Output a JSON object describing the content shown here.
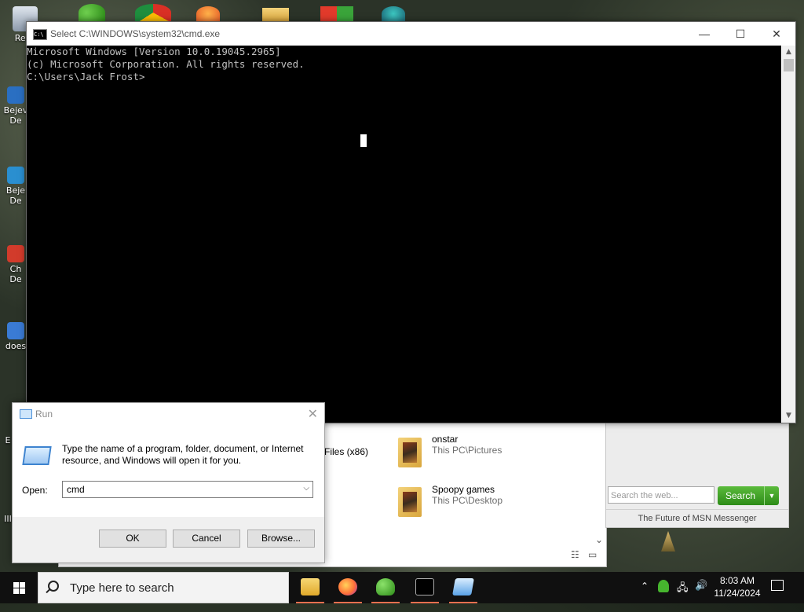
{
  "desktop": {
    "icons": [
      {
        "label": "Recy",
        "color": "#9aa7b8"
      },
      {
        "label": "Bejev\nDe",
        "color": "#2a6fc2"
      },
      {
        "label": "Beje\nDe",
        "color": "#2a8fd0"
      },
      {
        "label": "Ch\nDe",
        "color": "#d23b2b"
      },
      {
        "label": "does",
        "color": "#3a7bd5"
      },
      {
        "label": "E",
        "color": "#777"
      },
      {
        "label": "III",
        "color": "#777"
      }
    ]
  },
  "cmd": {
    "title": "Select C:\\WINDOWS\\system32\\cmd.exe",
    "lines": [
      "Microsoft Windows [Version 10.0.19045.2965]",
      "(c) Microsoft Corporation. All rights reserved.",
      "",
      "C:\\Users\\Jack Frost>"
    ],
    "minimize": "—",
    "maximize": "☐",
    "close": "✕"
  },
  "explorer": {
    "partial_label": "Files (x86)",
    "items": [
      {
        "name": "onstar",
        "path": "This PC\\Pictures"
      },
      {
        "name": "Spoopy games",
        "path": "This PC\\Desktop"
      }
    ]
  },
  "msn": {
    "search_placeholder": "Search the web...",
    "search_button": "Search",
    "footer": "The Future of MSN Messenger"
  },
  "run": {
    "title": "Run",
    "description": "Type the name of a program, folder, document, or Internet resource, and Windows will open it for you.",
    "open_label": "Open:",
    "open_value": "cmd",
    "ok": "OK",
    "cancel": "Cancel",
    "browse": "Browse..."
  },
  "taskbar": {
    "search_placeholder": "Type here to search",
    "time": "8:03 AM",
    "date": "11/24/2024"
  }
}
